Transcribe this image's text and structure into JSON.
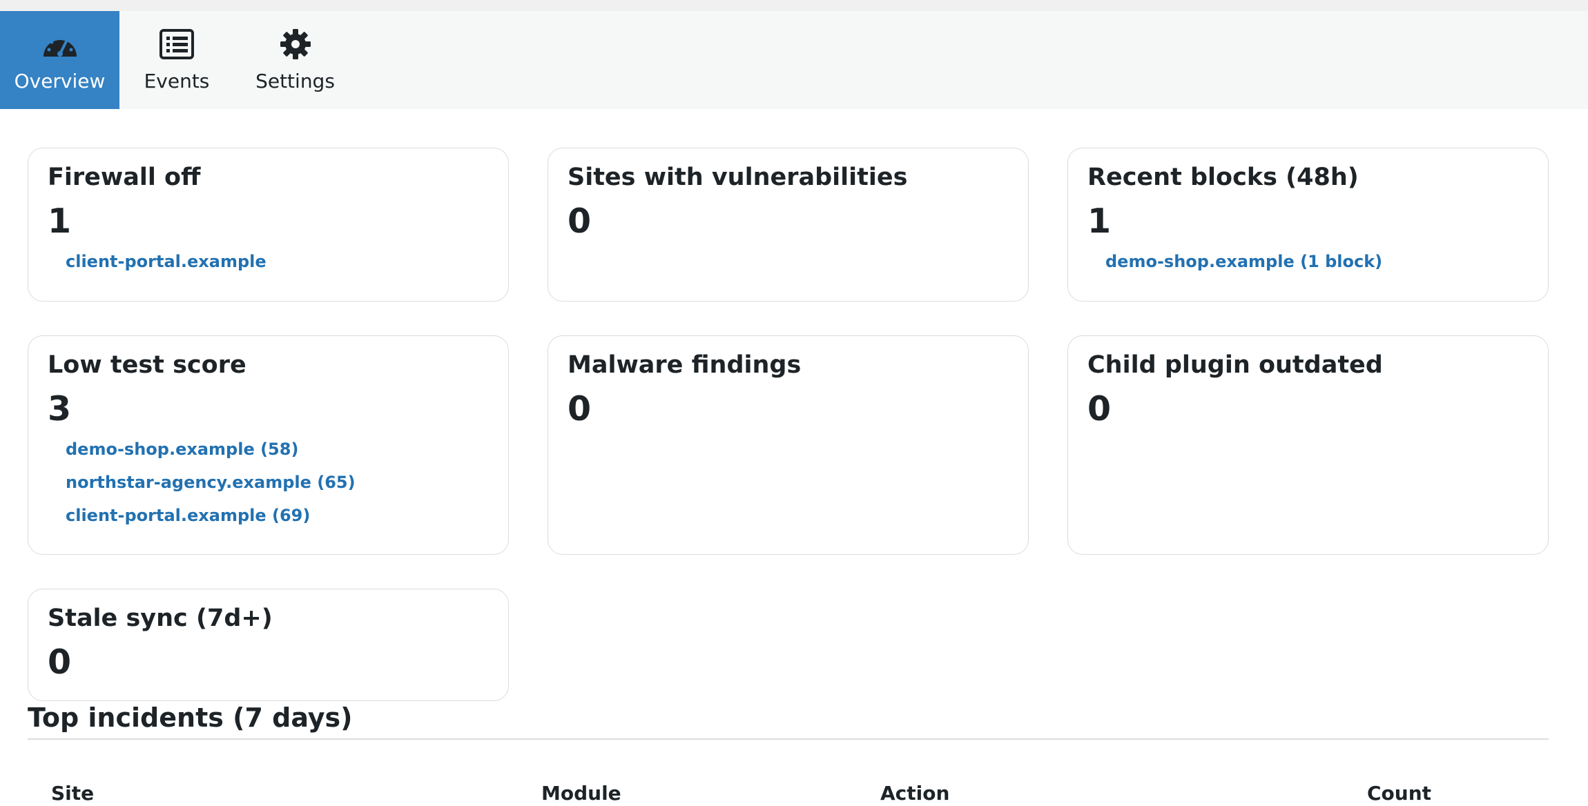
{
  "tabs": [
    {
      "label": "Overview",
      "icon": "dashboard-gauge-icon",
      "active": true
    },
    {
      "label": "Events",
      "icon": "list-view-icon",
      "active": false
    },
    {
      "label": "Settings",
      "icon": "gear-icon",
      "active": false
    }
  ],
  "cards": {
    "firewall_off": {
      "title": "Firewall off",
      "count": "1",
      "items": [
        "client-portal.example"
      ]
    },
    "vulnerabilities": {
      "title": "Sites with vulnerabilities",
      "count": "0",
      "items": []
    },
    "recent_blocks": {
      "title": "Recent blocks (48h)",
      "count": "1",
      "items": [
        "demo-shop.example (1 block)"
      ]
    },
    "low_test_score": {
      "title": "Low test score",
      "count": "3",
      "items": [
        "demo-shop.example (58)",
        "northstar-agency.example (65)",
        "client-portal.example (69)"
      ]
    },
    "malware": {
      "title": "Malware findings",
      "count": "0",
      "items": []
    },
    "child_plugin": {
      "title": "Child plugin outdated",
      "count": "0",
      "items": []
    },
    "stale_sync": {
      "title": "Stale sync (7d+)",
      "count": "0",
      "items": []
    }
  },
  "incidents": {
    "title": "Top incidents (7 days)",
    "columns": [
      "Site",
      "Module",
      "Action",
      "Count"
    ]
  },
  "colors": {
    "accent": "#3582c4",
    "link": "#2271b1",
    "border": "#dcdcde",
    "tabbar_bg": "#f6f7f7"
  }
}
